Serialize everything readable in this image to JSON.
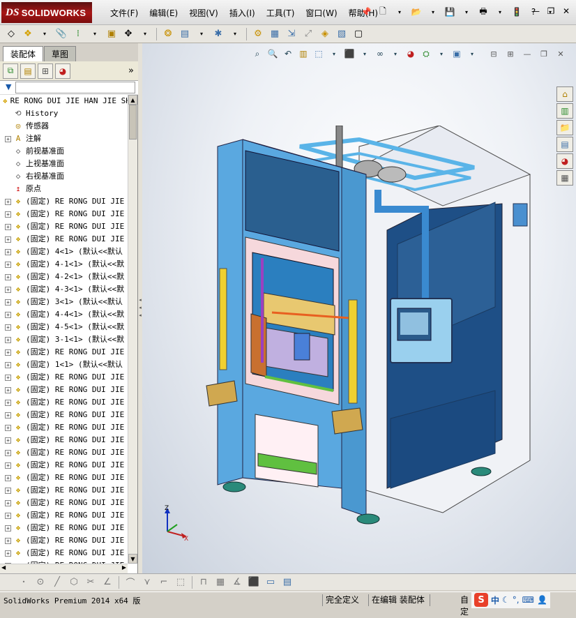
{
  "app": {
    "logo_prefix": "DS",
    "logo_text": "SOLIDWORKS"
  },
  "menu": [
    "文件(F)",
    "编辑(E)",
    "视图(V)",
    "插入(I)",
    "工具(T)",
    "窗口(W)",
    "帮助(H)"
  ],
  "top_icons": [
    "pin-icon",
    "new-file-icon",
    "open-file-icon",
    "save-icon",
    "print-icon",
    "traffic-light-icon",
    "help-icon"
  ],
  "window_buttons": [
    "minimize",
    "restore",
    "close"
  ],
  "tabs": [
    {
      "label": "装配体",
      "active": true
    },
    {
      "label": "草图",
      "active": false
    }
  ],
  "feature_manager": {
    "filter_placeholder": "",
    "root": "RE RONG DUI  JIE HAN JIE SHI",
    "items": [
      {
        "label": "History",
        "type": "history",
        "expandable": false
      },
      {
        "label": "传感器",
        "type": "sensor",
        "expandable": false
      },
      {
        "label": "注解",
        "type": "annotation",
        "expandable": true
      },
      {
        "label": "前视基准面",
        "type": "plane",
        "expandable": false
      },
      {
        "label": "上视基准面",
        "type": "plane",
        "expandable": false
      },
      {
        "label": "右视基准面",
        "type": "plane",
        "expandable": false
      },
      {
        "label": "原点",
        "type": "origin",
        "expandable": false
      },
      {
        "label": "(固定) RE RONG DUI  JIE",
        "type": "part",
        "expandable": true
      },
      {
        "label": "(固定) RE RONG DUI  JIE",
        "type": "part",
        "expandable": true
      },
      {
        "label": "(固定) RE RONG DUI  JIE",
        "type": "part",
        "expandable": true
      },
      {
        "label": "(固定) RE RONG DUI  JIE",
        "type": "part",
        "expandable": true
      },
      {
        "label": "(固定) 4<1> (默认<<默认",
        "type": "part",
        "expandable": true
      },
      {
        "label": "(固定) 4-1<1> (默认<<默",
        "type": "part",
        "expandable": true
      },
      {
        "label": "(固定) 4-2<1> (默认<<默",
        "type": "part",
        "expandable": true
      },
      {
        "label": "(固定) 4-3<1> (默认<<默",
        "type": "part",
        "expandable": true
      },
      {
        "label": "(固定) 3<1> (默认<<默认",
        "type": "part",
        "expandable": true
      },
      {
        "label": "(固定) 4-4<1> (默认<<默",
        "type": "part",
        "expandable": true
      },
      {
        "label": "(固定) 4-5<1> (默认<<默",
        "type": "part",
        "expandable": true
      },
      {
        "label": "(固定) 3-1<1> (默认<<默",
        "type": "part",
        "expandable": true
      },
      {
        "label": "(固定) RE RONG DUI  JIE",
        "type": "part",
        "expandable": true
      },
      {
        "label": "(固定) 1<1> (默认<<默认",
        "type": "part",
        "expandable": true
      },
      {
        "label": "(固定) RE RONG DUI  JIE",
        "type": "part",
        "expandable": true
      },
      {
        "label": "(固定) RE RONG DUI  JIE",
        "type": "part",
        "expandable": true
      },
      {
        "label": "(固定) RE RONG DUI  JIE",
        "type": "part",
        "expandable": true
      },
      {
        "label": "(固定) RE RONG DUI  JIE",
        "type": "part",
        "expandable": true
      },
      {
        "label": "(固定) RE RONG DUI  JIE",
        "type": "part",
        "expandable": true
      },
      {
        "label": "(固定) RE RONG DUI  JIE",
        "type": "part",
        "expandable": true
      },
      {
        "label": "(固定) RE RONG DUI  JIE",
        "type": "part",
        "expandable": true
      },
      {
        "label": "(固定) RE RONG DUI  JIE",
        "type": "part",
        "expandable": true
      },
      {
        "label": "(固定) RE RONG DUI  JIE",
        "type": "part",
        "expandable": true
      },
      {
        "label": "(固定) RE RONG DUI  JIE",
        "type": "part",
        "expandable": true
      },
      {
        "label": "(固定) RE RONG DUI  JIE",
        "type": "part",
        "expandable": true
      },
      {
        "label": "(固定) RE RONG DUI  JIE",
        "type": "part",
        "expandable": true
      },
      {
        "label": "(固定) RE RONG DUI  JIE",
        "type": "part",
        "expandable": true
      },
      {
        "label": "(固定) RE RONG DUI  JIE",
        "type": "part",
        "expandable": true
      },
      {
        "label": "(固定) RE RONG DUI  JIE",
        "type": "part",
        "expandable": true
      },
      {
        "label": "(固定) RE RONG DUI  JIE",
        "type": "part",
        "expandable": true
      }
    ]
  },
  "triad": {
    "z": "Z",
    "x": "X"
  },
  "status": {
    "product": "SolidWorks Premium 2014 x64 版",
    "definition": "完全定义",
    "mode": "在编辑 装配体",
    "custom": "自定"
  },
  "ime": {
    "lang": "中",
    "logo": "S"
  }
}
